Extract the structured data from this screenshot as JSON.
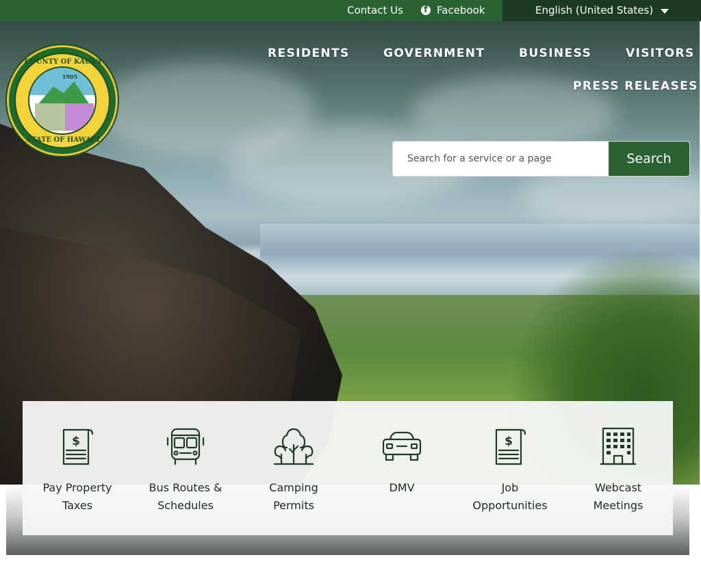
{
  "topbar": {
    "contact": "Contact Us",
    "facebook": "Facebook",
    "language": "English (United States)"
  },
  "logo": {
    "text_top": "COUNTY OF KAUA'I",
    "year": "1905",
    "text_bottom": "STATE OF HAWAI'I"
  },
  "nav": {
    "residents": "RESIDENTS",
    "government": "GOVERNMENT",
    "business": "BUSINESS",
    "visitors": "VISITORS",
    "press": "PRESS RELEASES"
  },
  "search": {
    "placeholder": "Search for a service or a page",
    "button": "Search"
  },
  "quick_links": [
    {
      "line1": "Pay Property",
      "line2": "Taxes",
      "icon": "receipt-dollar-icon"
    },
    {
      "line1": "Bus Routes &",
      "line2": "Schedules",
      "icon": "bus-icon"
    },
    {
      "line1": "Camping",
      "line2": "Permits",
      "icon": "trees-icon"
    },
    {
      "line1": "DMV",
      "line2": "",
      "icon": "car-icon"
    },
    {
      "line1": "Job",
      "line2": "Opportunities",
      "icon": "receipt-dollar-icon"
    },
    {
      "line1": "Webcast",
      "line2": "Meetings",
      "icon": "building-icon"
    }
  ],
  "colors": {
    "primary_green": "#2b6234",
    "dark_green": "#1d3a22",
    "icon_stroke": "#1f3a27"
  }
}
